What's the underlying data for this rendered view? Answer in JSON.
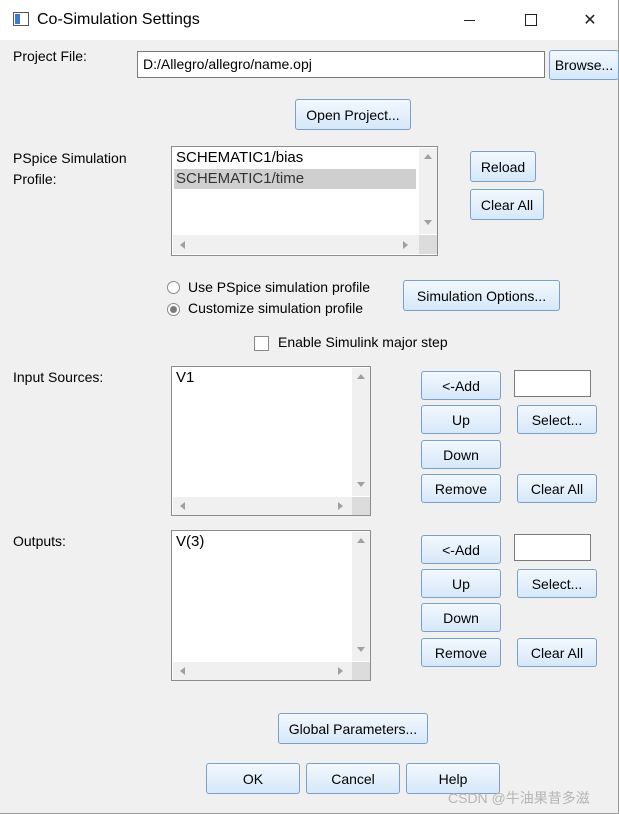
{
  "window": {
    "title": "Co-Simulation Settings",
    "controls": {
      "minimize": "—",
      "maximize": "☐",
      "close": "✕"
    }
  },
  "project_file": {
    "label": "Project File:",
    "value": "D:/Allegro/allegro/name.opj",
    "browse_button": "Browse...",
    "open_project_button": "Open Project..."
  },
  "profile": {
    "label_line1": "PSpice Simulation",
    "label_line2": "Profile:",
    "items": [
      "SCHEMATIC1/bias",
      "SCHEMATIC1/time"
    ],
    "selected_index": 1,
    "reload_button": "Reload",
    "clear_all_button": "Clear All"
  },
  "profile_mode": {
    "options": [
      "Use PSpice simulation profile",
      "Customize simulation profile"
    ],
    "selected": "Customize simulation profile",
    "simulation_options_button": "Simulation Options..."
  },
  "simulink": {
    "label": "Enable Simulink major step",
    "checked": false
  },
  "input_sources": {
    "label": "Input Sources:",
    "items": [
      "V1"
    ],
    "add_button": "<-Add",
    "up_button": "Up",
    "down_button": "Down",
    "remove_button": "Remove",
    "select_button": "Select...",
    "clear_all_button": "Clear All",
    "entry_value": ""
  },
  "outputs": {
    "label": "Outputs:",
    "items": [
      "V(3)"
    ],
    "add_button": "<-Add",
    "up_button": "Up",
    "down_button": "Down",
    "remove_button": "Remove",
    "select_button": "Select...",
    "clear_all_button": "Clear All",
    "entry_value": ""
  },
  "global_parameters_button": "Global Parameters...",
  "footer": {
    "ok": "OK",
    "cancel": "Cancel",
    "help": "Help"
  },
  "watermark": "CSDN @牛油果昔多滋"
}
